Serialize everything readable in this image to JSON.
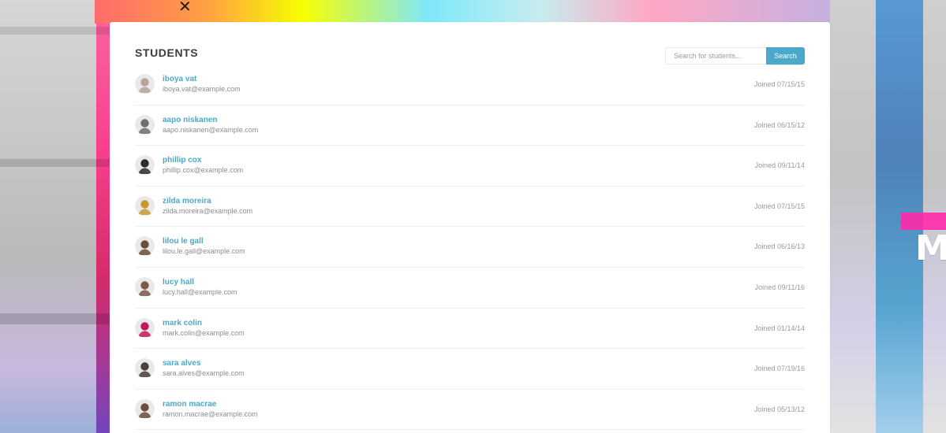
{
  "page": {
    "title": "STUDENTS"
  },
  "search": {
    "placeholder": "Search for students...",
    "button_label": "Search"
  },
  "students": [
    {
      "name": "iboya vat",
      "email": "iboya.vat@example.com",
      "joined": "Joined 07/15/15",
      "avatar_color": "#b9a39a"
    },
    {
      "name": "aapo niskanen",
      "email": "aapo.niskanen@example.com",
      "joined": "Joined 06/15/12",
      "avatar_color": "#6c6f72"
    },
    {
      "name": "phillip cox",
      "email": "phillip.cox@example.com",
      "joined": "Joined 09/11/14",
      "avatar_color": "#2b2b2b"
    },
    {
      "name": "zilda moreira",
      "email": "zilda.moreira@example.com",
      "joined": "Joined 07/15/15",
      "avatar_color": "#c59a2f"
    },
    {
      "name": "lilou le gall",
      "email": "lilou.le.gall@example.com",
      "joined": "Joined 06/16/13",
      "avatar_color": "#6b4e3a"
    },
    {
      "name": "lucy hall",
      "email": "lucy.hall@example.com",
      "joined": "Joined 09/11/16",
      "avatar_color": "#7b5a46"
    },
    {
      "name": "mark colin",
      "email": "mark.colin@example.com",
      "joined": "Joined 01/14/14",
      "avatar_color": "#c2185b"
    },
    {
      "name": "sara alves",
      "email": "sara.alves@example.com",
      "joined": "Joined 07/19/16",
      "avatar_color": "#4a3f3a"
    },
    {
      "name": "ramon macrae",
      "email": "ramon.macrae@example.com",
      "joined": "Joined 05/13/12",
      "avatar_color": "#6d4c41"
    }
  ],
  "colors": {
    "accent": "#4aa9c8",
    "card_background": "#ffffff",
    "text_title": "#3b3b3b",
    "text_muted": "#8d8d8d"
  },
  "background": {
    "decor_letter": "M",
    "decor_mark": "✕"
  }
}
